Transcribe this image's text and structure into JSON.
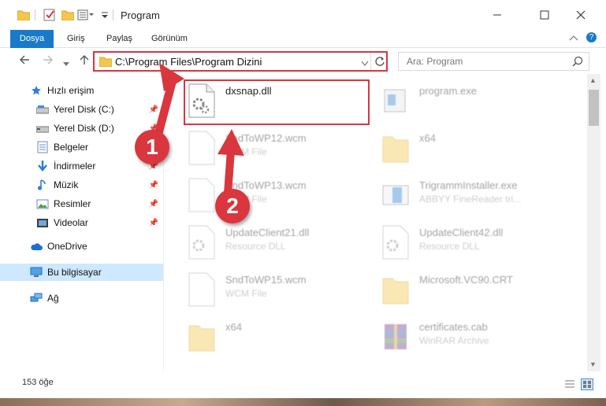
{
  "window": {
    "title": "Program"
  },
  "ribbon": {
    "tabs": [
      "Dosya",
      "Giriş",
      "Paylaş",
      "Görünüm"
    ]
  },
  "address": {
    "path": "C:\\Program Files\\Program Dizini"
  },
  "search": {
    "placeholder": "Ara: Program"
  },
  "nav": {
    "items": [
      {
        "label": "Hızlı erişim",
        "icon": "star-icon"
      },
      {
        "label": "Yerel Disk (C:)",
        "icon": "drive-icon"
      },
      {
        "label": "Yerel Disk (D:)",
        "icon": "drive-icon"
      },
      {
        "label": "Belgeler",
        "icon": "documents-icon"
      },
      {
        "label": "İndirmeler",
        "icon": "download-icon"
      },
      {
        "label": "Müzik",
        "icon": "music-icon"
      },
      {
        "label": "Resimler",
        "icon": "pictures-icon"
      },
      {
        "label": "Videolar",
        "icon": "videos-icon"
      },
      {
        "label": "OneDrive",
        "icon": "cloud-icon"
      },
      {
        "label": "Bu bilgisayar",
        "icon": "computer-icon"
      },
      {
        "label": "Ağ",
        "icon": "network-icon"
      }
    ]
  },
  "files": [
    {
      "name": "dxsnap.dll",
      "type": "",
      "icon": "dll-icon"
    },
    {
      "name": "program.exe",
      "type": "",
      "icon": "exe-icon"
    },
    {
      "name": "SndToWP12.wcm",
      "type": "WCM File",
      "icon": "file-icon"
    },
    {
      "name": "x64",
      "type": "",
      "icon": "folder-icon"
    },
    {
      "name": "SndToWP13.wcm",
      "type": "WCM File",
      "icon": "file-icon"
    },
    {
      "name": "TrigrammInstaller.exe",
      "type": "ABBYY FineReader tri...",
      "icon": "installer-icon"
    },
    {
      "name": "UpdateClient21.dll",
      "type": "Resource DLL",
      "icon": "dll-icon"
    },
    {
      "name": "UpdateClient42.dll",
      "type": "Resource DLL",
      "icon": "dll-icon"
    },
    {
      "name": "SndToWP15.wcm",
      "type": "WCM File",
      "icon": "file-icon"
    },
    {
      "name": "Microsoft.VC90.CRT",
      "type": "",
      "icon": "folder-icon"
    },
    {
      "name": "x64",
      "type": "",
      "icon": "folder-icon"
    },
    {
      "name": "certificates.cab",
      "type": "WinRAR Archive",
      "icon": "archive-icon"
    }
  ],
  "status": {
    "count": "153 öğe"
  },
  "annotations": {
    "badge1": "1",
    "badge2": "2"
  },
  "colors": {
    "accent": "#1979ca",
    "highlight": "#d9363e"
  }
}
